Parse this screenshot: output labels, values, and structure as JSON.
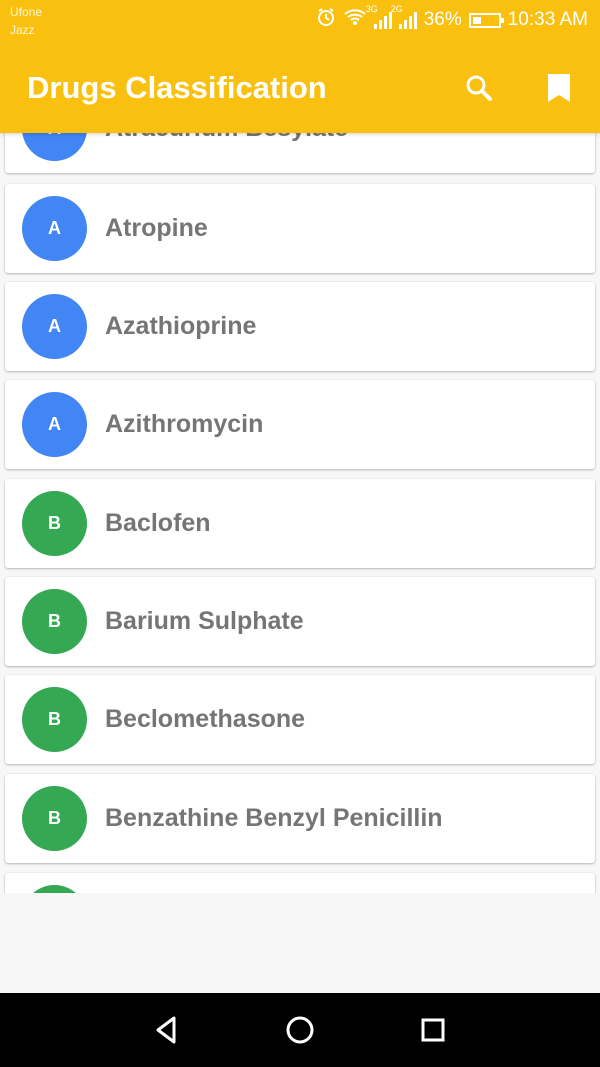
{
  "status_bar": {
    "carrier_1": "Ufone",
    "carrier_2": "Jazz",
    "signal_1_type": "3G",
    "signal_2_type": "2G",
    "battery_percent": "36%",
    "battery_level": 0.36,
    "time": "10:33 AM",
    "icons": [
      "alarm-icon",
      "wifi-icon",
      "signal-icon",
      "battery-icon"
    ]
  },
  "app_bar": {
    "title": "Drugs Classification",
    "background_color": "#f9c00f",
    "actions": [
      "search-icon",
      "bookmark-icon"
    ]
  },
  "colors": {
    "avatar_a": "#4285f4",
    "avatar_b": "#34a853",
    "drug_text": "#757575"
  },
  "drugs": [
    {
      "letter": "A",
      "name": "Atracurium Besylate",
      "color": "#4285f4"
    },
    {
      "letter": "A",
      "name": "Atropine",
      "color": "#4285f4"
    },
    {
      "letter": "A",
      "name": "Azathioprine",
      "color": "#4285f4"
    },
    {
      "letter": "A",
      "name": "Azithromycin",
      "color": "#4285f4"
    },
    {
      "letter": "B",
      "name": "Baclofen",
      "color": "#34a853"
    },
    {
      "letter": "B",
      "name": "Barium Sulphate",
      "color": "#34a853"
    },
    {
      "letter": "B",
      "name": "Beclomethasone",
      "color": "#34a853"
    },
    {
      "letter": "B",
      "name": "Benzathine Benzyl Penicillin",
      "color": "#34a853"
    },
    {
      "letter": "",
      "name": "",
      "color": "#34a853"
    }
  ],
  "navigation": [
    "back-icon",
    "home-icon",
    "recents-icon"
  ]
}
